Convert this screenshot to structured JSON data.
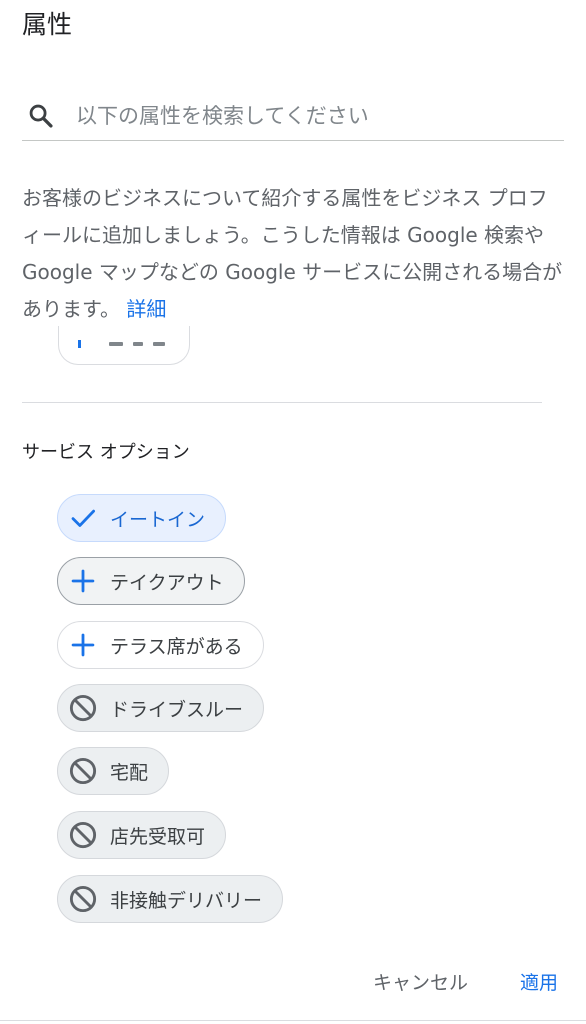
{
  "header": {
    "title": "属性"
  },
  "search": {
    "placeholder": "以下の属性を検索してください",
    "value": ""
  },
  "description": {
    "text": "お客様のビジネスについて紹介する属性をビジネス プロフィールに追加しましょう。こうした情報は Google 検索や Google マップなどの Google サービスに公開される場合があります。 ",
    "link_label": "詳細"
  },
  "section": {
    "title": "サービス オプション"
  },
  "chips": [
    {
      "label": "イートイン",
      "state": "selected",
      "icon": "check-icon"
    },
    {
      "label": "テイクアウト",
      "state": "added",
      "icon": "plus-icon"
    },
    {
      "label": "テラス席がある",
      "state": "outline",
      "icon": "plus-icon"
    },
    {
      "label": "ドライブスルー",
      "state": "blocked",
      "icon": "block-icon"
    },
    {
      "label": "宅配",
      "state": "blocked",
      "icon": "block-icon"
    },
    {
      "label": "店先受取可",
      "state": "blocked",
      "icon": "block-icon"
    },
    {
      "label": "非接触デリバリー",
      "state": "blocked",
      "icon": "block-icon"
    }
  ],
  "footer": {
    "cancel_label": "キャンセル",
    "apply_label": "適用"
  },
  "colors": {
    "accent": "#1a73e8",
    "selected_bg": "#e8f0fe",
    "blocked_bg": "#eceff1"
  }
}
